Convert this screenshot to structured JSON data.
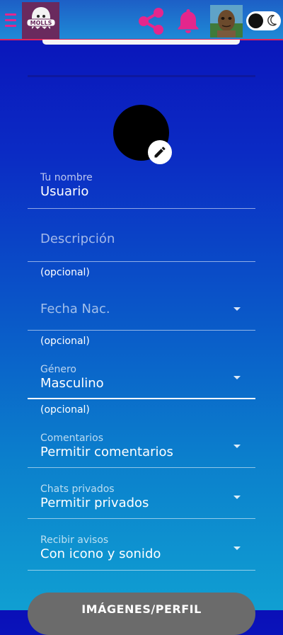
{
  "header": {
    "logo_text": "MOLLS",
    "icons": {
      "menu": "menu-icon",
      "share": "share-icon",
      "notifications": "bell-icon",
      "theme": "moon-icon"
    },
    "accent_color": "#e4268c"
  },
  "profile": {
    "edit_icon": "pencil-icon"
  },
  "form": {
    "name": {
      "label": "Tu nombre",
      "value": "Usuario"
    },
    "description": {
      "placeholder": "Descripción",
      "helper": "(opcional)"
    },
    "birthdate": {
      "placeholder": "Fecha Nac.",
      "helper": "(opcional)"
    },
    "gender": {
      "label": "Género",
      "value": "Masculino",
      "helper": "(opcional)"
    },
    "comments": {
      "label": "Comentarios",
      "value": "Permitir comentarios"
    },
    "private_chats": {
      "label": "Chats privados",
      "value": "Permitir privados"
    },
    "notifications": {
      "label": "Recibir avisos",
      "value": "Con icono y sonido"
    }
  },
  "buttons": {
    "profile_images": "IMÁGENES/PERFIL"
  }
}
